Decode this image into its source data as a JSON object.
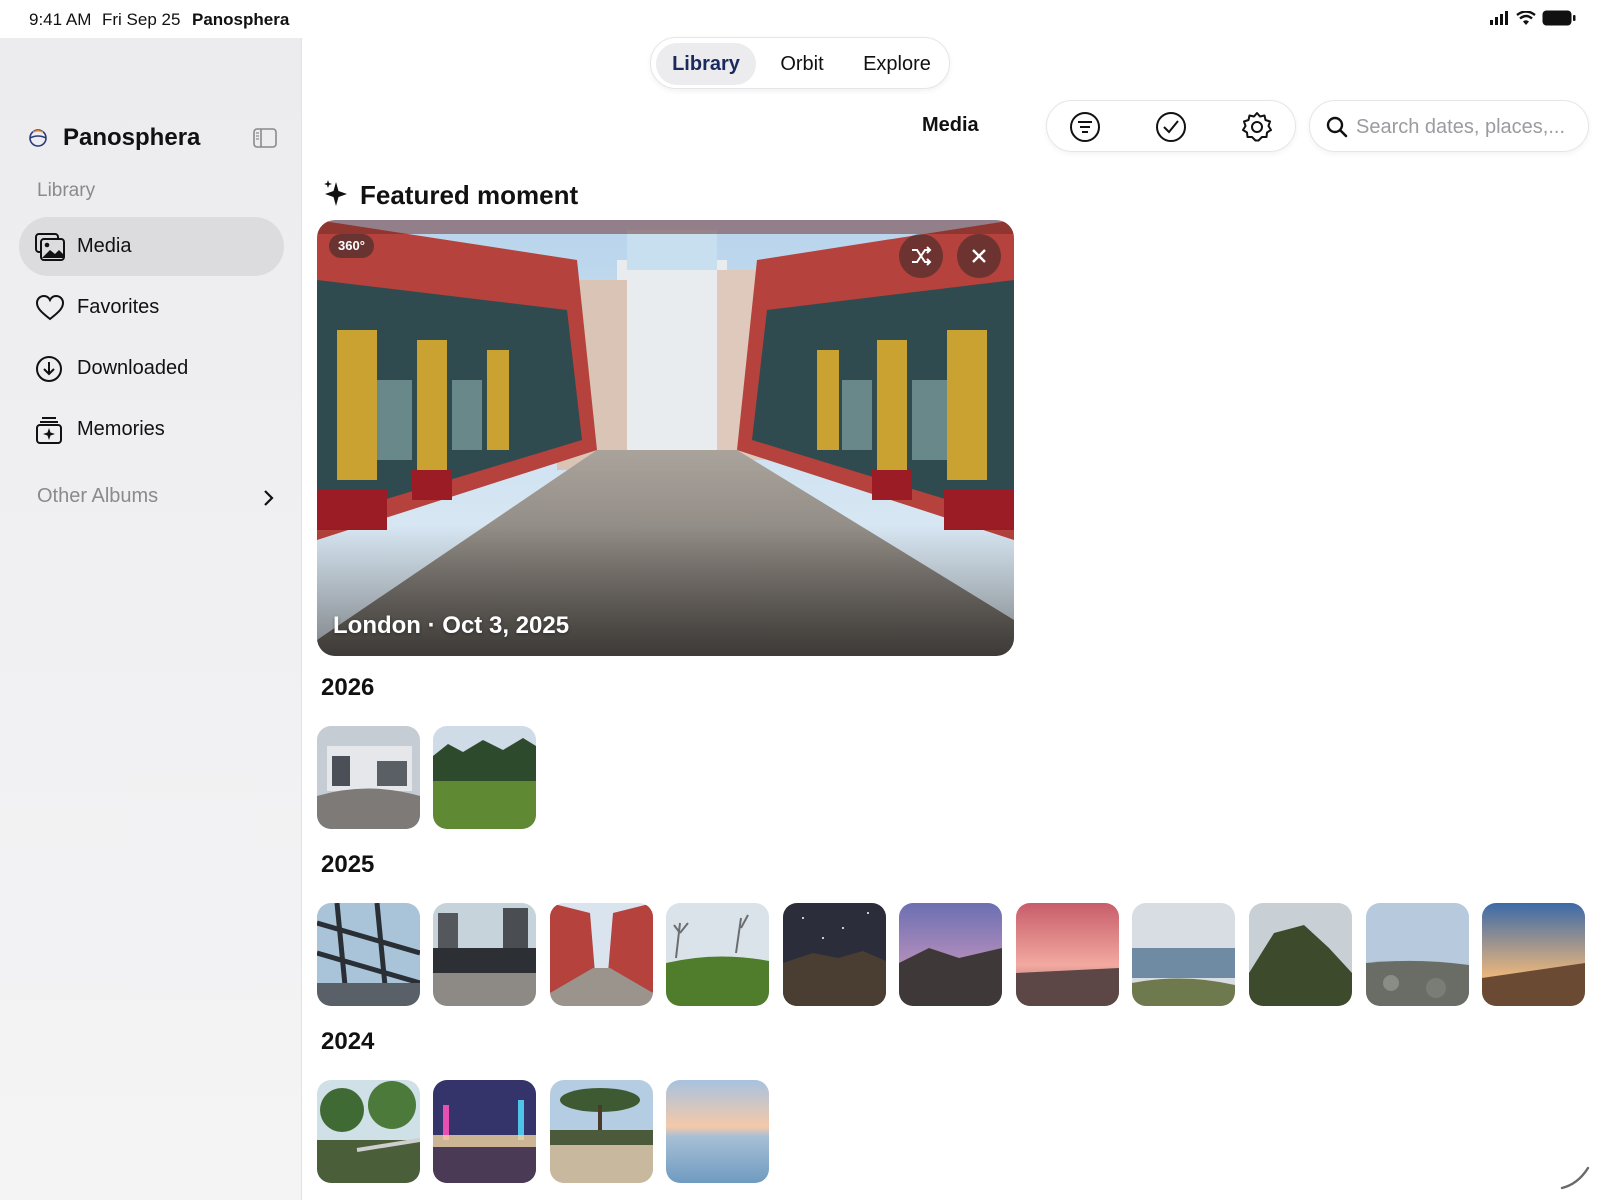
{
  "status_bar": {
    "time": "9:41 AM",
    "date": "Fri Sep 25",
    "app": "Panosphera"
  },
  "sidebar": {
    "title": "Panosphera",
    "section": "Library",
    "items": [
      {
        "label": "Media",
        "icon": "photos-icon",
        "active": true
      },
      {
        "label": "Favorites",
        "icon": "heart-icon",
        "active": false
      },
      {
        "label": "Downloaded",
        "icon": "download-icon",
        "active": false
      },
      {
        "label": "Memories",
        "icon": "memories-icon",
        "active": false
      }
    ],
    "other_albums": "Other Albums"
  },
  "tabs": [
    {
      "label": "Library",
      "active": true
    },
    {
      "label": "Orbit",
      "active": false
    },
    {
      "label": "Explore",
      "active": false
    }
  ],
  "toolbar": {
    "title": "Media",
    "buttons": [
      "filter-icon",
      "select-icon",
      "settings-icon"
    ],
    "search_placeholder": "Search dates, places,..."
  },
  "featured": {
    "heading": "Featured moment",
    "badge": "360°",
    "caption": "London · Oct 3, 2025"
  },
  "years": [
    {
      "year": "2026",
      "thumbnails": 2
    },
    {
      "year": "2025",
      "thumbnails": 11
    },
    {
      "year": "2024",
      "thumbnails": 4
    }
  ],
  "colors": {
    "accent": "#1a2a5e",
    "sidebar_bg": "#ececee",
    "active_item": "#dcdcde"
  }
}
